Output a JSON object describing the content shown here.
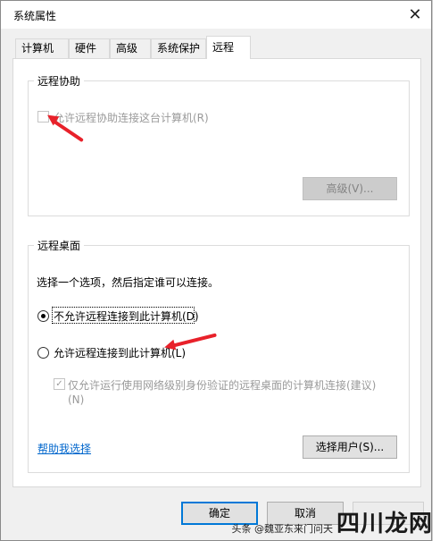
{
  "window": {
    "title": "系统属性",
    "close_glyph": "✕"
  },
  "tabs": [
    {
      "label": "计算机名"
    },
    {
      "label": "硬件"
    },
    {
      "label": "高级"
    },
    {
      "label": "系统保护"
    },
    {
      "label": "远程",
      "active": true
    }
  ],
  "remote_assistance": {
    "title": "远程协助",
    "allow_label": "允许远程协助连接这台计算机(R)",
    "allow_checked": false,
    "advanced_button": "高级(V)..."
  },
  "remote_desktop": {
    "title": "远程桌面",
    "instruction": "选择一个选项，然后指定谁可以连接。",
    "option_disallow": "不允许远程连接到此计算机(D)",
    "option_allow": "允许远程连接到此计算机(L)",
    "selected": "disallow",
    "nla_label_line1": "仅允许运行使用网络级别身份验证的远程桌面的计算机连接(建议)",
    "nla_label_line2": "(N)",
    "nla_checked": true,
    "help_link": "帮助我选择",
    "select_users_button": "选择用户(S)..."
  },
  "footer": {
    "ok_button": "确定",
    "cancel_button": "取消"
  },
  "watermark": {
    "text": "头条 @魏亚东来门问天",
    "logo": "四川龙网"
  },
  "colors": {
    "accent": "#0078d7",
    "annotation_arrow": "#e8212a",
    "link": "#0066cc"
  }
}
